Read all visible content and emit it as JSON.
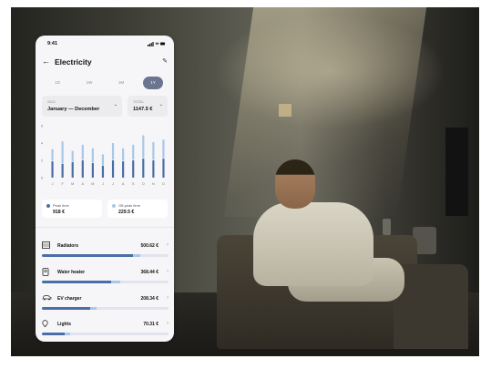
{
  "status_bar": {
    "time": "9:41",
    "icons": "signal wifi battery"
  },
  "header": {
    "title": "Electricity",
    "back_icon": "arrow-left-icon",
    "edit_icon": "pencil-icon"
  },
  "periods": [
    {
      "label": "1D",
      "active": false
    },
    {
      "label": "1W",
      "active": false
    },
    {
      "label": "1M",
      "active": false
    },
    {
      "label": "1Y",
      "active": true
    }
  ],
  "range": {
    "year": "2023",
    "label": "January — December"
  },
  "total": {
    "label": "TOTAL",
    "value": "1147.5 €"
  },
  "colors": {
    "peak": "#4a6ea6",
    "offpeak": "#a8c8e8",
    "active_period": "#6c7590"
  },
  "chart_data": {
    "type": "bar",
    "stacked": true,
    "categories": [
      "J",
      "F",
      "M",
      "A",
      "M",
      "J",
      "J",
      "A",
      "S",
      "O",
      "N",
      "D"
    ],
    "y_ticks": [
      "6",
      "4",
      "2",
      "0"
    ],
    "ylim": [
      0,
      6
    ],
    "series": [
      {
        "name": "Peak time",
        "values": [
          1.9,
          1.6,
          1.8,
          2.0,
          1.7,
          1.4,
          2.0,
          1.9,
          2.0,
          2.2,
          2.0,
          2.2
        ]
      },
      {
        "name": "Off-peak time",
        "values": [
          1.4,
          2.6,
          1.3,
          1.8,
          1.7,
          1.3,
          2.0,
          1.5,
          1.8,
          2.7,
          2.1,
          2.2
        ]
      }
    ]
  },
  "peak": {
    "label": "Peak time",
    "value": "918 €"
  },
  "offpeak": {
    "label": "Off-peak time",
    "value": "229.5 €"
  },
  "devices": [
    {
      "name": "Radiators",
      "icon": "radiator-icon",
      "value": "500.62 €",
      "peak_share": 0.72,
      "offpeak_share": 0.06
    },
    {
      "name": "Water heater",
      "icon": "water-heater-icon",
      "value": "368.44 €",
      "peak_share": 0.55,
      "offpeak_share": 0.07
    },
    {
      "name": "EV charger",
      "icon": "ev-charger-icon",
      "value": "208.34 €",
      "peak_share": 0.38,
      "offpeak_share": 0.05
    },
    {
      "name": "Lights",
      "icon": "lightbulb-icon",
      "value": "70.31 €",
      "peak_share": 0.18,
      "offpeak_share": 0.04
    }
  ]
}
